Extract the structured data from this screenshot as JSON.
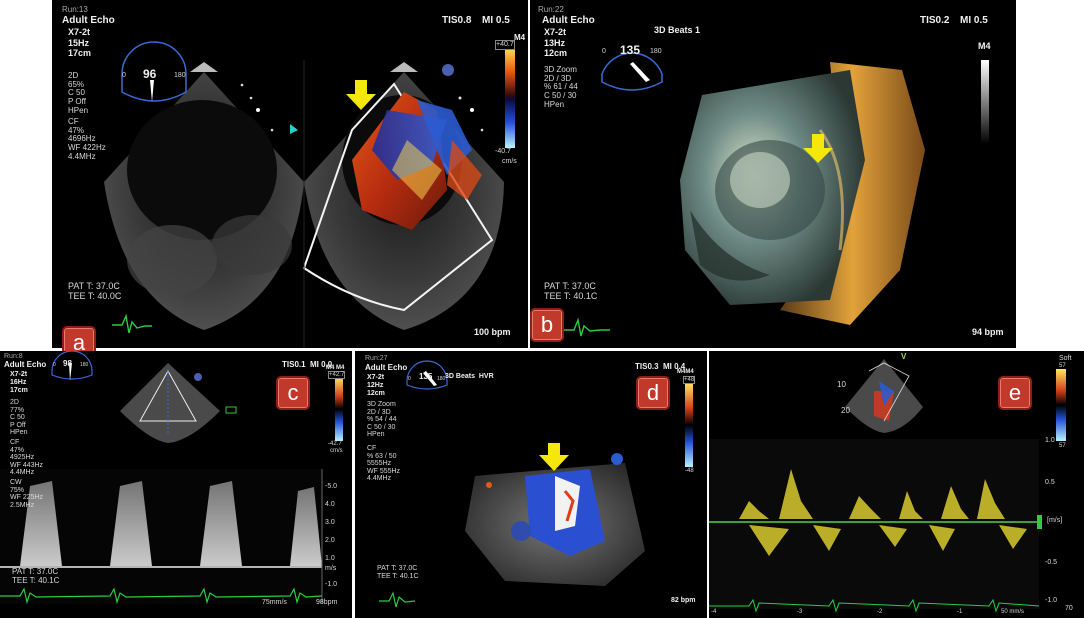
{
  "panel_a": {
    "badge": "a",
    "run": "Run:13",
    "mode": "Adult Echo",
    "probe": "X7-2t",
    "rate": "15Hz",
    "depth": "17cm",
    "tis": "TIS0.8",
    "mi": "MI 0.5",
    "angle": "96",
    "angle_min": "0",
    "angle_max": "180",
    "settings_2d": "2D\n65%\nC 50\nP Off\nHPen",
    "settings_cf": "CF\n47%\n4696Hz\nWF 422Hz\n4.4MHz",
    "scale_mode": "M4",
    "scale_top": "+40.7",
    "scale_bottom": "-40.7",
    "scale_unit": "cm/s",
    "temps": "PAT T: 37.0C\nTEE T: 40.0C",
    "bpm": "100 bpm"
  },
  "panel_b": {
    "badge": "b",
    "run": "Run:22",
    "mode": "Adult Echo",
    "probe": "X7-2t",
    "rate": "13Hz",
    "depth": "12cm",
    "title": "3D Beats 1",
    "tis": "TIS0.2",
    "mi": "MI 0.5",
    "angle": "135",
    "angle_min": "0",
    "angle_max": "180",
    "zoom": "3D Zoom\n2D / 3D\n% 61 / 44\nC 50 / 30\nHPen",
    "scale_mode": "M4",
    "temps": "PAT T: 37.0C\nTEE T: 40.1C",
    "bpm": "94 bpm"
  },
  "panel_c": {
    "badge": "c",
    "run": "Run:8",
    "mode": "Adult Echo",
    "probe": "X7-2t",
    "rate": "16Hz",
    "depth": "17cm",
    "tis": "TIS0.1",
    "mi": "MI 0.0",
    "angle": "98",
    "angle_min": "0",
    "angle_max": "180",
    "settings_2d": "2D\n77%\nC 50\nP Off\nHPen",
    "settings_cf": "CF\n47%\n4925Hz\nWF 443Hz\n4.4MHz",
    "settings_cw": "CW\n75%\nWF 225Hz\n2.5MHz",
    "scale_mode": "M4 M4",
    "scale_top": "+42.7",
    "scale_bottom": "-42.7",
    "scale_unit": "cm/s",
    "axis_ticks": [
      "-5.0",
      "4.0",
      "3.0",
      "2.0",
      "1.0",
      "m/s",
      "-1.0"
    ],
    "temps": "PAT T: 37.0C\nTEE T: 40.1C",
    "sweep": "75mm/s",
    "bpm": "98bpm"
  },
  "panel_d": {
    "badge": "d",
    "run": "Run:27",
    "mode": "Adult Echo",
    "probe": "X7-2t",
    "rate": "12Hz",
    "depth": "12cm",
    "title": "3D Beats  HVR",
    "tis": "TIS0.3",
    "mi": "MI 0.4",
    "angle": "135",
    "angle_min": "0",
    "angle_max": "180",
    "zoom": "3D Zoom\n2D / 3D\n% 54 / 44\nC 50 / 30\nHPen",
    "settings_cf": "CF\n% 63 / 50\n5555Hz\nWF 555Hz\n4.4MHz",
    "scale_mode": "M4M4",
    "scale_top": "+48",
    "scale_bottom": "-48",
    "temps": "PAT T: 37.0C\nTEE T: 40.1C",
    "bpm": "82 bpm"
  },
  "panel_e": {
    "badge": "e",
    "marker": "V",
    "depth_ticks": [
      "10",
      "20"
    ],
    "scale_label": "Soft",
    "scale_top": "57",
    "scale_bottom": "57",
    "axis_ticks": [
      "1.0",
      "0.5",
      "[m/s]",
      "-0.5",
      "-1.0"
    ],
    "time_ticks": [
      "-4",
      "-3",
      "-2",
      "-1"
    ],
    "sweep": "50 mm/s",
    "hr": "70"
  },
  "colors": {
    "badge": "#c0392b",
    "arrow": "#f5e60c",
    "ecg": "#2ecc40",
    "doppler": "#e6d830",
    "flow_red": "#d83a1a",
    "flow_blue": "#1f4fd8"
  }
}
